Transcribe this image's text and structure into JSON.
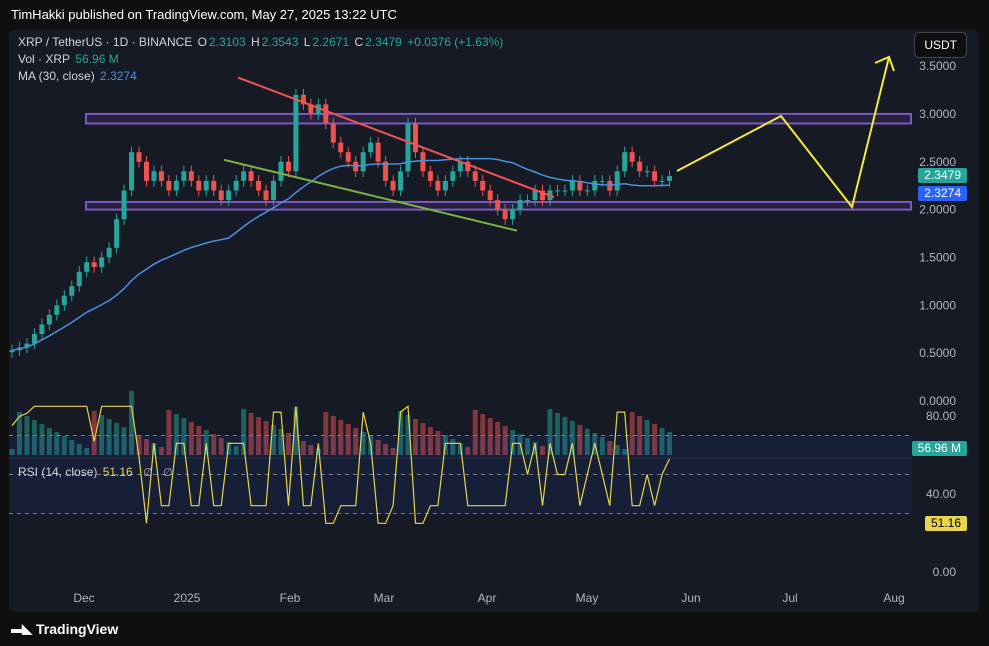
{
  "header": {
    "publisher": "TimHakki published on TradingView.com, May 27, 2025 13:22 UTC"
  },
  "legend": {
    "symbol": "XRP / TetherUS · 1D · BINANCE",
    "o_label": "O",
    "o_value": "2.3103",
    "h_label": "H",
    "h_value": "2.3543",
    "l_label": "L",
    "l_value": "2.2671",
    "c_label": "C",
    "c_value": "2.3479",
    "change": "+0.0376 (+1.63%)",
    "vol_label": "Vol · XRP",
    "vol_value": "56.96 M",
    "ma_label": "MA (30, close)",
    "ma_value": "2.3274"
  },
  "rsi_legend": {
    "label": "RSI (14, close)",
    "value": "51.16",
    "icon1": "∅",
    "icon2": "∅"
  },
  "currency_button": "USDT",
  "price_axis": [
    "3.5000",
    "3.0000",
    "2.5000",
    "2.0000",
    "1.5000",
    "1.0000",
    "0.5000",
    "0.0000"
  ],
  "rsi_axis": [
    "80.00",
    "40.00",
    "0.00"
  ],
  "time_axis": [
    "Dec",
    "2025",
    "Feb",
    "Mar",
    "Apr",
    "May",
    "Jun",
    "Jul",
    "Aug"
  ],
  "badges": {
    "price": "2.3479",
    "ma": "2.3274",
    "volume": "56.96 M",
    "rsi": "51.16"
  },
  "colors": {
    "up": "#26a69a",
    "down": "#ef5350",
    "ma": "#4a90e2",
    "rsi": "#e8d44d",
    "purple": "#7e57c2",
    "red_line": "#ef5350",
    "green_line": "#7cb342",
    "arrow": "#f5e93a"
  },
  "footer": {
    "logo": "TradingView"
  },
  "chart_data": {
    "type": "candlestick",
    "symbol": "XRP / TetherUS",
    "interval": "1D",
    "exchange": "BINANCE",
    "ylim": [
      0,
      3.6
    ],
    "close_series_approx": [
      0.53,
      0.56,
      0.6,
      0.7,
      0.8,
      0.9,
      1.0,
      1.1,
      1.2,
      1.35,
      1.45,
      1.4,
      1.5,
      1.6,
      1.9,
      2.2,
      2.6,
      2.5,
      2.3,
      2.4,
      2.3,
      2.2,
      2.3,
      2.4,
      2.3,
      2.2,
      2.3,
      2.2,
      2.1,
      2.2,
      2.3,
      2.4,
      2.3,
      2.2,
      2.1,
      2.3,
      2.5,
      2.4,
      3.2,
      3.1,
      3.0,
      3.1,
      2.9,
      2.7,
      2.6,
      2.5,
      2.4,
      2.6,
      2.7,
      2.5,
      2.3,
      2.2,
      2.4,
      2.9,
      2.6,
      2.4,
      2.3,
      2.2,
      2.3,
      2.4,
      2.5,
      2.4,
      2.3,
      2.2,
      2.1,
      2.0,
      1.9,
      2.0,
      2.1,
      2.1,
      2.2,
      2.1,
      2.2,
      2.2,
      2.2,
      2.3,
      2.2,
      2.2,
      2.3,
      2.3,
      2.2,
      2.4,
      2.6,
      2.5,
      2.4,
      2.4,
      2.3,
      2.3,
      2.35
    ],
    "current_close": 2.3479,
    "ma30_current": 2.3274,
    "rsi_current": 51.16,
    "rsi_levels": [
      70,
      50,
      30
    ],
    "volume_current": "56.96 M"
  }
}
